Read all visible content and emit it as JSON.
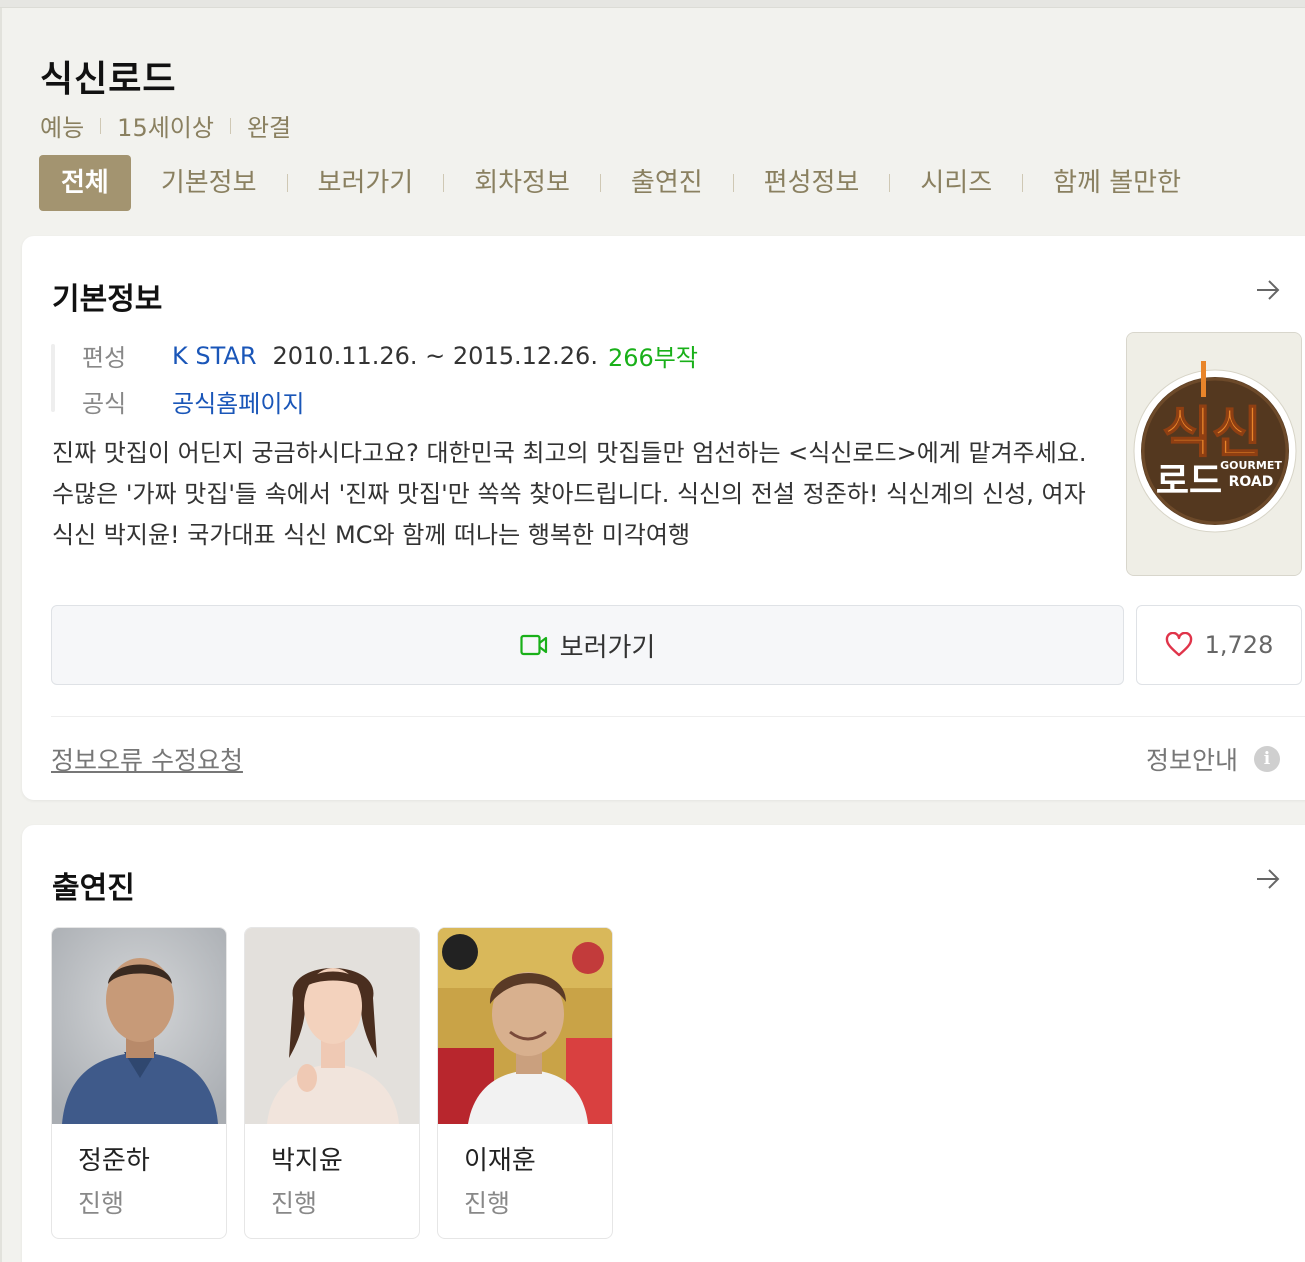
{
  "program": {
    "title": "식신로드",
    "meta": [
      "예능",
      "15세이상",
      "완결"
    ]
  },
  "tabs": [
    {
      "label": "전체",
      "active": true
    },
    {
      "label": "기본정보"
    },
    {
      "label": "보러가기"
    },
    {
      "label": "회차정보"
    },
    {
      "label": "출연진"
    },
    {
      "label": "편성정보"
    },
    {
      "label": "시리즈"
    },
    {
      "label": "함께 볼만한"
    }
  ],
  "basic_info": {
    "section_title": "기본정보",
    "broadcast_label": "편성",
    "channel": "K STAR",
    "period": "2010.11.26. ~ 2015.12.26.",
    "episodes": "266부작",
    "official_label": "공식",
    "official_link": "공식홈페이지",
    "description": "진짜 맛집이 어딘지 궁금하시다고요? 대한민국 최고의 맛집들만 엄선하는 <식신로드>에게 맡겨주세요. 수많은 '가짜 맛집'들 속에서 '진짜 맛집'만 쏙쏙 찾아드립니다. 식신의 전설 정준하! 식신계의 신성, 여자 식신 박지윤! 국가대표 식신 MC와 함께 떠나는 행복한 미각여행",
    "poster": {
      "line1": "식신",
      "line2": "로드",
      "sub1": "GOURMET",
      "sub2": "ROAD"
    },
    "watch_label": "보러가기",
    "like_count": "1,728",
    "report_link": "정보오류 수정요청",
    "info_guide": "정보안내",
    "info_icon_glyph": "i"
  },
  "cast_section": {
    "section_title": "출연진",
    "members": [
      {
        "name": "정준하",
        "role": "진행"
      },
      {
        "name": "박지윤",
        "role": "진행"
      },
      {
        "name": "이재훈",
        "role": "진행"
      }
    ]
  },
  "colors": {
    "accent": "#a39470",
    "tab_text": "#8a8060",
    "link_blue": "#1a56b8",
    "episodes_green": "#19b019",
    "heart_red": "#e0344a"
  }
}
